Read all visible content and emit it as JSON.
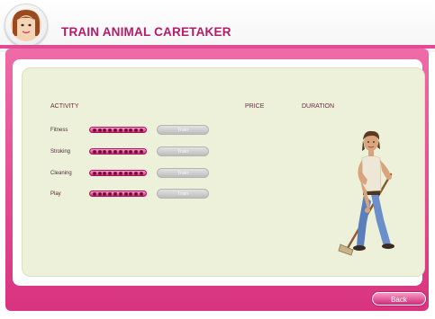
{
  "header": {
    "title": "TRAIN ANIMAL CARETAKER"
  },
  "table": {
    "columns": {
      "activity": "ACTIVITY",
      "price": "PRICE",
      "duration": "DURATION"
    },
    "rows": [
      {
        "label": "Fitness",
        "level": 10,
        "max": 10,
        "button": "Train"
      },
      {
        "label": "Stroking",
        "level": 10,
        "max": 10,
        "button": "Train"
      },
      {
        "label": "Cleaning",
        "level": 10,
        "max": 10,
        "button": "Train"
      },
      {
        "label": "Play",
        "level": 10,
        "max": 10,
        "button": "Train"
      }
    ]
  },
  "footer": {
    "back_label": "Back"
  },
  "colors": {
    "accent": "#d9337f",
    "title": "#b31c6a",
    "panel": "#eef1d9"
  },
  "icons": {
    "avatar": "player-avatar-icon",
    "character": "caretaker-figure"
  }
}
